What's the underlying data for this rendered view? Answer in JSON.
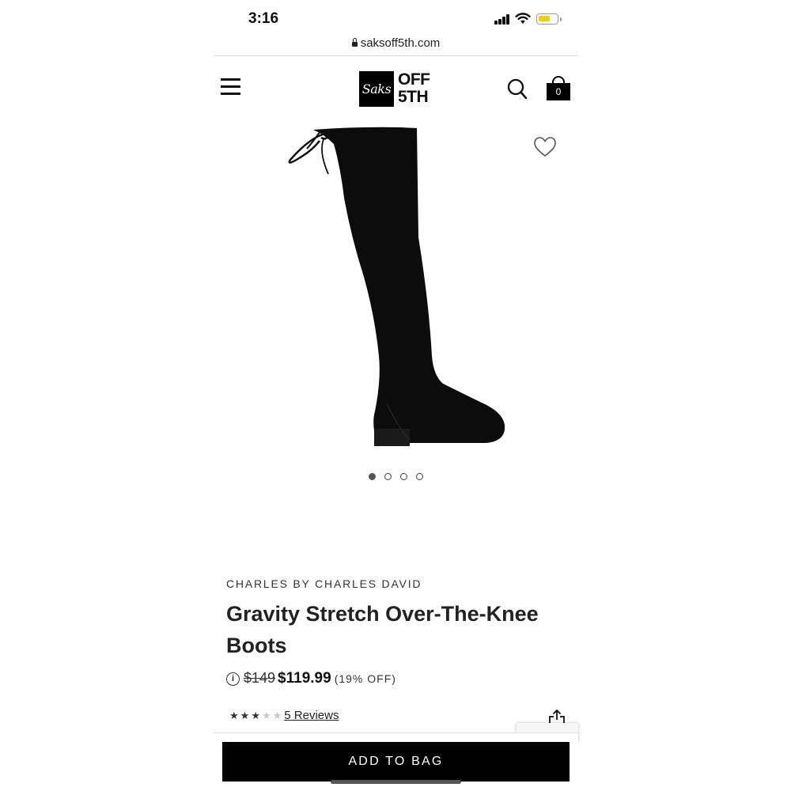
{
  "status_bar": {
    "time": "3:16"
  },
  "browser": {
    "url": "saksoff5th.com"
  },
  "header": {
    "logo_script": "Saks",
    "logo_line1": "OFF",
    "logo_line2": "5TH",
    "bag_count": "0"
  },
  "carousel": {
    "total": 4,
    "active_index": 0
  },
  "product": {
    "brand": "CHARLES BY CHARLES DAVID",
    "name": "Gravity Stretch Over-The-Knee Boots",
    "original_price": "$149",
    "sale_price": "$119.99",
    "discount": "(19% OFF)",
    "rating": 3,
    "rating_max": 5,
    "reviews_label": "5 Reviews",
    "image_icon": "black-over-the-knee-boot"
  },
  "actions": {
    "add_to_bag": "ADD TO BAG"
  },
  "colors": {
    "brand": "#000000",
    "battery": "#f5cb1a",
    "text": "#222222"
  }
}
